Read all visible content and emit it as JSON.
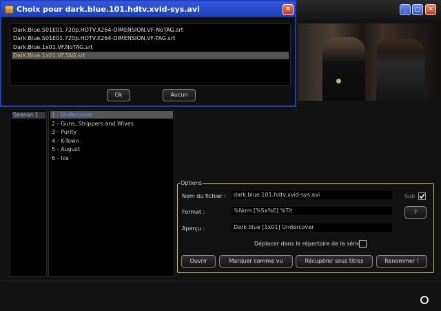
{
  "dialog": {
    "title": "Choix pour dark.blue.101.hdtv.xvid-sys.avi",
    "files": [
      "Dark.Blue.S01E01.720p.HDTV.X264-DIMENSION.VF-NoTAG.srt",
      "Dark.Blue.S01E01.720p.HDTV.X264-DIMENSION.VF-TAG.srt",
      "Dark.Blue.1x01.VF.NoTAG.srt",
      "Dark.Blue.1x01.VF.TAG.srt"
    ],
    "selected_file": 3,
    "ok_label": "Ok",
    "cancel_label": "Aucun",
    "close_glyph": "✕"
  },
  "main": {
    "minimize_glyph": "_",
    "maximize_glyph": "□",
    "close_glyph": "✕"
  },
  "seasons": [
    "Season 1"
  ],
  "episodes": [
    "1 - Undercover",
    "2 - Guns, Strippers and Wives",
    "3 - Purity",
    "4 - K-Town",
    "5 - August",
    "6 - Ice"
  ],
  "selected_episode": 0,
  "options": {
    "legend": "Options",
    "filename_label": "Nom du fichier :",
    "filename_value": "dark.blue.101.hdtv.xvid-sys.avi",
    "sub_label": "Sub",
    "sub_checked": true,
    "format_label": "Format :",
    "format_value": "%Nom [%Sx%E] %Tit",
    "format_help_label": "?",
    "preview_label": "Aperçu :",
    "preview_value": "Dark blue [1x01] Undercover",
    "move_label": "Déplacer dans le répertoire de la série",
    "move_checked": false,
    "open_label": "Ouvrir",
    "mark_seen_label": "Marquer comme vu",
    "fetch_titles_label": "Récupérer sous titres",
    "rename_label": "Renommer !"
  },
  "colors": {
    "dialog_border": "#1f3fbf",
    "options_border": "#c8c84a",
    "selection_text": "#6aa4ff"
  }
}
